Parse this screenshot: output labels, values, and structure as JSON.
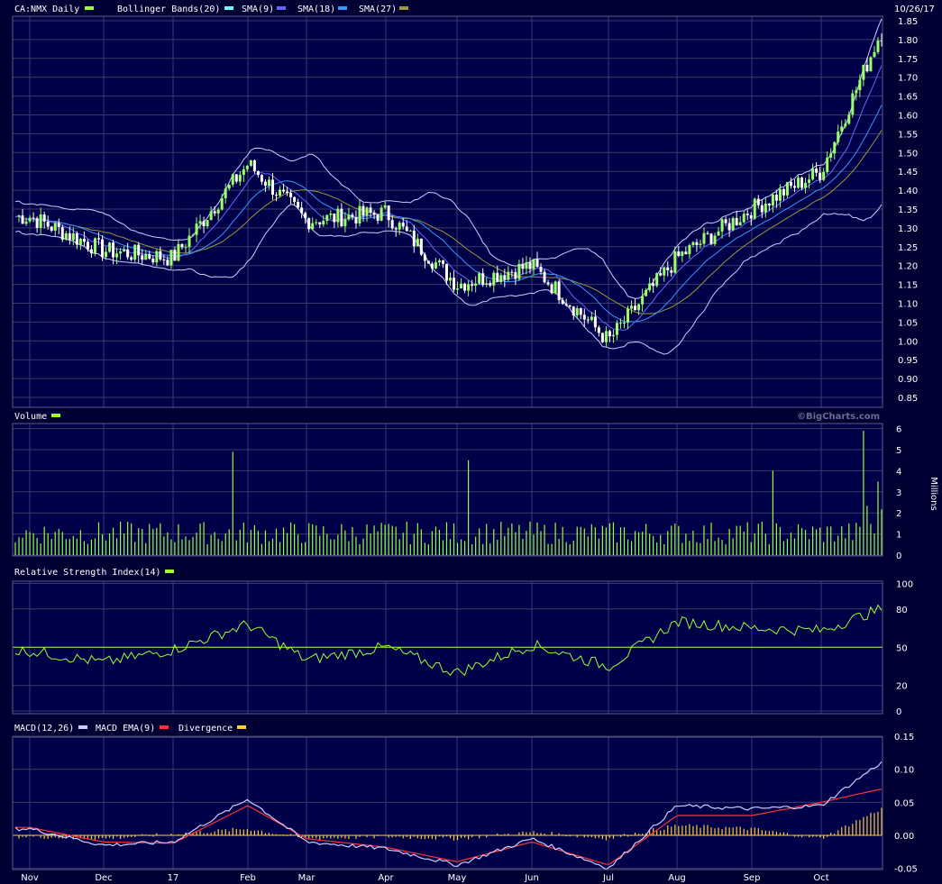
{
  "colors": {
    "background": "#000033",
    "panel": "#000048",
    "grid": "#3a3a6a",
    "candle_up": "#99ff66",
    "candle_down": "#ffffff",
    "bollinger": "#ccccff",
    "sma9": "#6666ff",
    "sma18": "#3399ff",
    "sma27": "#999933",
    "volume": "#99ff33",
    "rsi": "#99ff33",
    "rsi_mid": "#99ff33",
    "macd": "#ccccff",
    "macd_ema": "#ff3333",
    "divergence": "#ffcc33",
    "watermark": "#6b6b8f"
  },
  "price_panel": {
    "symbol_label": "CA:NMX Daily",
    "indicators": [
      {
        "label": "Bollinger Bands(20)",
        "color": "#66ffff"
      },
      {
        "label": "SMA(9)",
        "color": "#6666ff"
      },
      {
        "label": "SMA(18)",
        "color": "#3399ff"
      },
      {
        "label": "SMA(27)",
        "color": "#999933"
      }
    ],
    "date_label": "10/26/17",
    "y_ticks": [
      "1.85",
      "1.80",
      "1.75",
      "1.70",
      "1.65",
      "1.60",
      "1.55",
      "1.50",
      "1.45",
      "1.40",
      "1.35",
      "1.30",
      "1.25",
      "1.20",
      "1.15",
      "1.10",
      "1.05",
      "1.00",
      "0.95",
      "0.90",
      "0.85"
    ],
    "watermark": "©BigCharts.com"
  },
  "volume_panel": {
    "label": "Volume",
    "y_ticks": [
      "6",
      "5",
      "4",
      "3",
      "2",
      "1",
      "0"
    ],
    "unit_label": "Millions"
  },
  "rsi_panel": {
    "label": "Relative Strength Index(14)",
    "y_ticks": [
      "100",
      "80",
      "50",
      "20",
      "0"
    ]
  },
  "macd_panel": {
    "label_macd": "MACD(12,26)",
    "label_ema": "MACD EMA(9)",
    "label_div": "Divergence",
    "y_ticks": [
      "0.15",
      "0.10",
      "0.05",
      "0.00",
      "-0.05"
    ],
    "x_ticks": [
      "Nov",
      "Dec",
      "17",
      "Feb",
      "Mar",
      "Apr",
      "May",
      "Jun",
      "Jul",
      "Aug",
      "Sep",
      "Oct"
    ]
  },
  "chart_data": [
    {
      "type": "line",
      "title": "CA:NMX Daily",
      "x": [
        "Nov 2016",
        "Dec 2016",
        "Jan 2017",
        "Feb 2017",
        "Mar 2017",
        "Apr 2017",
        "May 2017",
        "Jun 2017",
        "Jul 2017",
        "Aug 2017",
        "Sep 2017",
        "Oct 2017",
        "10/26/17"
      ],
      "series": [
        {
          "name": "CA:NMX Daily",
          "values": [
            1.33,
            1.24,
            1.22,
            1.47,
            1.32,
            1.34,
            1.15,
            1.2,
            1.0,
            1.22,
            1.35,
            1.45,
            1.82
          ]
        }
      ],
      "ylim": [
        0.85,
        1.85
      ]
    },
    {
      "type": "bar",
      "title": "Volume",
      "ylabel": "Millions",
      "ylim": [
        0,
        6
      ],
      "spikes": [
        {
          "x": "Jan 2017",
          "value": 4.9
        },
        {
          "x": "May 2017",
          "value": 4.5
        },
        {
          "x": "Sep 2017",
          "value": 4.0
        },
        {
          "x": "10/26/17",
          "value": 5.9
        }
      ]
    },
    {
      "type": "line",
      "title": "Relative Strength Index(14)",
      "ylim": [
        0,
        100
      ],
      "x": [
        "Nov 2016",
        "Dec 2016",
        "Jan 2017",
        "Feb 2017",
        "Mar 2017",
        "Apr 2017",
        "May 2017",
        "Jun 2017",
        "Jul 2017",
        "Aug 2017",
        "Sep 2017",
        "Oct 2017",
        "10/26/17"
      ],
      "series": [
        {
          "name": "Relative Strength Index(14)",
          "values": [
            47,
            38,
            48,
            68,
            40,
            50,
            30,
            52,
            35,
            70,
            65,
            63,
            80
          ]
        }
      ]
    },
    {
      "type": "line",
      "title": "MACD(12,26)",
      "ylim": [
        -0.05,
        0.15
      ],
      "x": [
        "Nov 2016",
        "Dec 2016",
        "Jan 2017",
        "Feb 2017",
        "Mar 2017",
        "Apr 2017",
        "May 2017",
        "Jun 2017",
        "Jul 2017",
        "Aug 2017",
        "Sep 2017",
        "Oct 2017",
        "10/26/17"
      ],
      "series": [
        {
          "name": "MACD(12,26)",
          "values": [
            0.01,
            -0.015,
            -0.01,
            0.055,
            -0.01,
            -0.02,
            -0.045,
            -0.005,
            -0.05,
            0.045,
            0.04,
            0.045,
            0.11
          ]
        },
        {
          "name": "MACD EMA(9)",
          "values": [
            0.012,
            -0.01,
            -0.012,
            0.045,
            -0.005,
            -0.018,
            -0.04,
            -0.01,
            -0.045,
            0.03,
            0.03,
            0.05,
            0.07
          ]
        }
      ]
    }
  ]
}
